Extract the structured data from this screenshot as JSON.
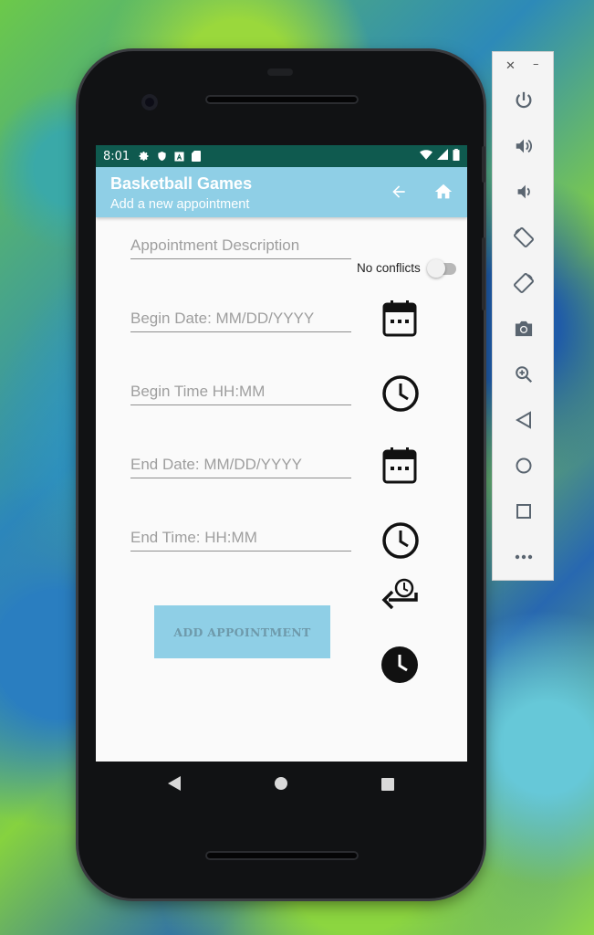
{
  "statusbar": {
    "time": "8:01"
  },
  "appbar": {
    "title": "Basketball Games",
    "subtitle": "Add a new appointment"
  },
  "form": {
    "description_placeholder": "Appointment Description",
    "conflicts_label": "No conflicts",
    "conflicts_toggle_on": false,
    "begin_date_placeholder": "Begin Date: MM/DD/YYYY",
    "begin_time_placeholder": "Begin Time HH:MM",
    "end_date_placeholder": "End Date: MM/DD/YYYY",
    "end_time_placeholder": "End Time: HH:MM",
    "add_button_label": "ADD APPOINTMENT"
  },
  "icons": {
    "statusbar": [
      "settings-icon",
      "shield-icon",
      "a-badge-icon",
      "sd-card-icon",
      "wifi-icon",
      "signal-icon",
      "battery-icon"
    ],
    "appbar": [
      "back-arrow-icon",
      "home-icon"
    ],
    "form": [
      "calendar-icon",
      "clock-icon",
      "calendar-icon",
      "clock-icon",
      "time-restore-icon",
      "clock-filled-icon"
    ],
    "navbar": [
      "back-triangle-icon",
      "home-circle-icon",
      "recents-square-icon"
    ],
    "emulator": [
      "power-icon",
      "volume-up-icon",
      "volume-down-icon",
      "rotate-left-icon",
      "rotate-right-icon",
      "camera-icon",
      "zoom-icon",
      "back-icon",
      "home-icon",
      "overview-icon",
      "more-icon"
    ]
  },
  "colors": {
    "statusbar": "#0f5a4f",
    "appbar": "#8fcfe6",
    "button": "#8fcfe6",
    "button_text": "#6e9aab"
  }
}
